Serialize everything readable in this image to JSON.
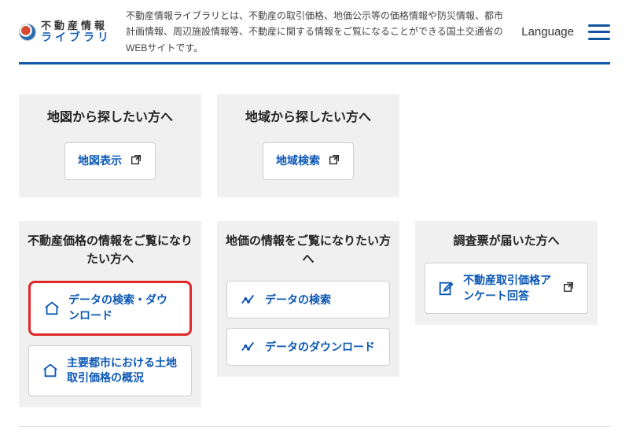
{
  "header": {
    "logo_top": "不動産情報",
    "logo_bottom": "ライブラリ",
    "tagline": "不動産情報ライブラリとは、不動産の取引価格、地価公示等の価格情報や防災情報、都市計画情報、周辺施設情報等、不動産に関する情報をご覧になることができる国土交通省のWEBサイトです。",
    "language_label": "Language"
  },
  "group1": {
    "map_panel": {
      "title": "地図から探したい方へ",
      "button_label": "地図表示"
    },
    "region_panel": {
      "title": "地域から探したい方へ",
      "button_label": "地域検索"
    }
  },
  "group2": {
    "price_col": {
      "title": "不動産価格の情報をご覧になりたい方へ",
      "btn1": "データの検索・ダウンロード",
      "btn2": "主要都市における土地取引価格の概況"
    },
    "land_col": {
      "title": "地価の情報をご覧になりたい方へ",
      "btn1": "データの検索",
      "btn2": "データのダウンロード"
    },
    "survey_col": {
      "title": "調査票が届いた方へ",
      "btn1": "不動産取引価格アンケート回答"
    }
  }
}
